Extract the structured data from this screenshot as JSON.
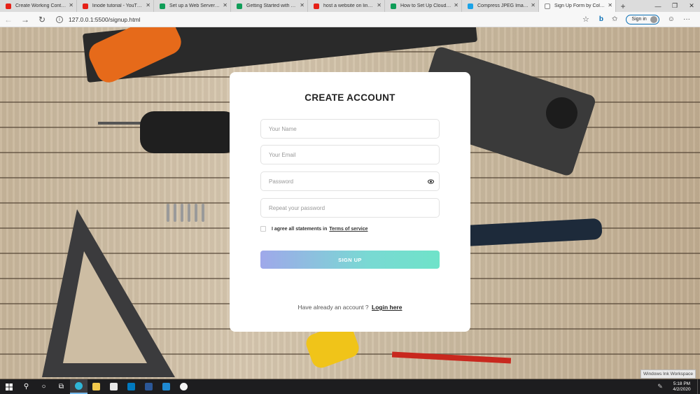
{
  "browser": {
    "tabs": [
      {
        "label": "Create Working Contact Fo",
        "favicon": "youtube-icon",
        "color": "#e62117",
        "active": false
      },
      {
        "label": "linode tutorial - YouTube",
        "favicon": "youtube-icon",
        "color": "#e62117",
        "active": false
      },
      {
        "label": "Set up a Web Server and H",
        "favicon": "document-icon",
        "color": "#0f9d58",
        "active": false
      },
      {
        "label": "Getting Started with NGINX",
        "favicon": "document-icon",
        "color": "#0f9d58",
        "active": false
      },
      {
        "label": "host a website on linode -",
        "favicon": "youtube-icon",
        "color": "#e62117",
        "active": false
      },
      {
        "label": "How to Set Up Cloudflare w",
        "favicon": "document-icon",
        "color": "#0f9d58",
        "active": false
      },
      {
        "label": "Compress JPEG Images Onl",
        "favicon": "compress-icon",
        "color": "#1aa3e8",
        "active": false
      },
      {
        "label": "Sign Up Form by Colorlib",
        "favicon": "page-icon",
        "color": "#ffffff",
        "active": true
      }
    ],
    "url": "127.0.0.1:5500/signup.html",
    "signin_label": "Sign in"
  },
  "form": {
    "title": "CREATE ACCOUNT",
    "name_placeholder": "Your Name",
    "email_placeholder": "Your Email",
    "password_placeholder": "Password",
    "repeat_placeholder": "Repeat your password",
    "agree_text": "I agree all statements in",
    "terms_link": "Terms of service",
    "submit_label": "SIGN UP",
    "login_prompt": "Have already an account ?",
    "login_link": "Login here",
    "gradient_start": "#9fa8ea",
    "gradient_end": "#6fe3c9"
  },
  "ink_workspace_label": "Windows Ink Workspace",
  "taskbar": {
    "time": "5:18 PM",
    "date": "4/2/2020"
  }
}
